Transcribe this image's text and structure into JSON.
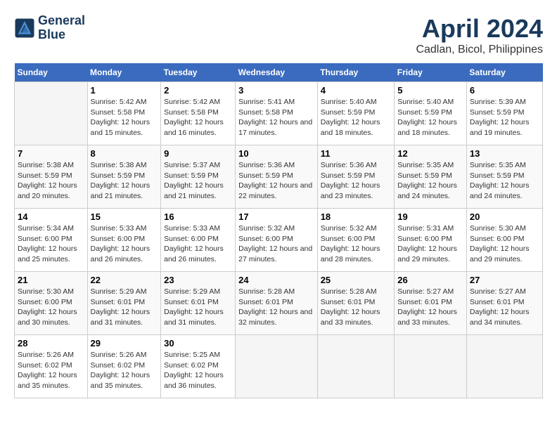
{
  "logo": {
    "line1": "General",
    "line2": "Blue"
  },
  "title": "April 2024",
  "subtitle": "Cadlan, Bicol, Philippines",
  "days_header": [
    "Sunday",
    "Monday",
    "Tuesday",
    "Wednesday",
    "Thursday",
    "Friday",
    "Saturday"
  ],
  "weeks": [
    [
      {
        "num": "",
        "sunrise": "",
        "sunset": "",
        "daylight": ""
      },
      {
        "num": "1",
        "sunrise": "Sunrise: 5:42 AM",
        "sunset": "Sunset: 5:58 PM",
        "daylight": "Daylight: 12 hours and 15 minutes."
      },
      {
        "num": "2",
        "sunrise": "Sunrise: 5:42 AM",
        "sunset": "Sunset: 5:58 PM",
        "daylight": "Daylight: 12 hours and 16 minutes."
      },
      {
        "num": "3",
        "sunrise": "Sunrise: 5:41 AM",
        "sunset": "Sunset: 5:58 PM",
        "daylight": "Daylight: 12 hours and 17 minutes."
      },
      {
        "num": "4",
        "sunrise": "Sunrise: 5:40 AM",
        "sunset": "Sunset: 5:59 PM",
        "daylight": "Daylight: 12 hours and 18 minutes."
      },
      {
        "num": "5",
        "sunrise": "Sunrise: 5:40 AM",
        "sunset": "Sunset: 5:59 PM",
        "daylight": "Daylight: 12 hours and 18 minutes."
      },
      {
        "num": "6",
        "sunrise": "Sunrise: 5:39 AM",
        "sunset": "Sunset: 5:59 PM",
        "daylight": "Daylight: 12 hours and 19 minutes."
      }
    ],
    [
      {
        "num": "7",
        "sunrise": "Sunrise: 5:38 AM",
        "sunset": "Sunset: 5:59 PM",
        "daylight": "Daylight: 12 hours and 20 minutes."
      },
      {
        "num": "8",
        "sunrise": "Sunrise: 5:38 AM",
        "sunset": "Sunset: 5:59 PM",
        "daylight": "Daylight: 12 hours and 21 minutes."
      },
      {
        "num": "9",
        "sunrise": "Sunrise: 5:37 AM",
        "sunset": "Sunset: 5:59 PM",
        "daylight": "Daylight: 12 hours and 21 minutes."
      },
      {
        "num": "10",
        "sunrise": "Sunrise: 5:36 AM",
        "sunset": "Sunset: 5:59 PM",
        "daylight": "Daylight: 12 hours and 22 minutes."
      },
      {
        "num": "11",
        "sunrise": "Sunrise: 5:36 AM",
        "sunset": "Sunset: 5:59 PM",
        "daylight": "Daylight: 12 hours and 23 minutes."
      },
      {
        "num": "12",
        "sunrise": "Sunrise: 5:35 AM",
        "sunset": "Sunset: 5:59 PM",
        "daylight": "Daylight: 12 hours and 24 minutes."
      },
      {
        "num": "13",
        "sunrise": "Sunrise: 5:35 AM",
        "sunset": "Sunset: 5:59 PM",
        "daylight": "Daylight: 12 hours and 24 minutes."
      }
    ],
    [
      {
        "num": "14",
        "sunrise": "Sunrise: 5:34 AM",
        "sunset": "Sunset: 6:00 PM",
        "daylight": "Daylight: 12 hours and 25 minutes."
      },
      {
        "num": "15",
        "sunrise": "Sunrise: 5:33 AM",
        "sunset": "Sunset: 6:00 PM",
        "daylight": "Daylight: 12 hours and 26 minutes."
      },
      {
        "num": "16",
        "sunrise": "Sunrise: 5:33 AM",
        "sunset": "Sunset: 6:00 PM",
        "daylight": "Daylight: 12 hours and 26 minutes."
      },
      {
        "num": "17",
        "sunrise": "Sunrise: 5:32 AM",
        "sunset": "Sunset: 6:00 PM",
        "daylight": "Daylight: 12 hours and 27 minutes."
      },
      {
        "num": "18",
        "sunrise": "Sunrise: 5:32 AM",
        "sunset": "Sunset: 6:00 PM",
        "daylight": "Daylight: 12 hours and 28 minutes."
      },
      {
        "num": "19",
        "sunrise": "Sunrise: 5:31 AM",
        "sunset": "Sunset: 6:00 PM",
        "daylight": "Daylight: 12 hours and 29 minutes."
      },
      {
        "num": "20",
        "sunrise": "Sunrise: 5:30 AM",
        "sunset": "Sunset: 6:00 PM",
        "daylight": "Daylight: 12 hours and 29 minutes."
      }
    ],
    [
      {
        "num": "21",
        "sunrise": "Sunrise: 5:30 AM",
        "sunset": "Sunset: 6:00 PM",
        "daylight": "Daylight: 12 hours and 30 minutes."
      },
      {
        "num": "22",
        "sunrise": "Sunrise: 5:29 AM",
        "sunset": "Sunset: 6:01 PM",
        "daylight": "Daylight: 12 hours and 31 minutes."
      },
      {
        "num": "23",
        "sunrise": "Sunrise: 5:29 AM",
        "sunset": "Sunset: 6:01 PM",
        "daylight": "Daylight: 12 hours and 31 minutes."
      },
      {
        "num": "24",
        "sunrise": "Sunrise: 5:28 AM",
        "sunset": "Sunset: 6:01 PM",
        "daylight": "Daylight: 12 hours and 32 minutes."
      },
      {
        "num": "25",
        "sunrise": "Sunrise: 5:28 AM",
        "sunset": "Sunset: 6:01 PM",
        "daylight": "Daylight: 12 hours and 33 minutes."
      },
      {
        "num": "26",
        "sunrise": "Sunrise: 5:27 AM",
        "sunset": "Sunset: 6:01 PM",
        "daylight": "Daylight: 12 hours and 33 minutes."
      },
      {
        "num": "27",
        "sunrise": "Sunrise: 5:27 AM",
        "sunset": "Sunset: 6:01 PM",
        "daylight": "Daylight: 12 hours and 34 minutes."
      }
    ],
    [
      {
        "num": "28",
        "sunrise": "Sunrise: 5:26 AM",
        "sunset": "Sunset: 6:02 PM",
        "daylight": "Daylight: 12 hours and 35 minutes."
      },
      {
        "num": "29",
        "sunrise": "Sunrise: 5:26 AM",
        "sunset": "Sunset: 6:02 PM",
        "daylight": "Daylight: 12 hours and 35 minutes."
      },
      {
        "num": "30",
        "sunrise": "Sunrise: 5:25 AM",
        "sunset": "Sunset: 6:02 PM",
        "daylight": "Daylight: 12 hours and 36 minutes."
      },
      {
        "num": "",
        "sunrise": "",
        "sunset": "",
        "daylight": ""
      },
      {
        "num": "",
        "sunrise": "",
        "sunset": "",
        "daylight": ""
      },
      {
        "num": "",
        "sunrise": "",
        "sunset": "",
        "daylight": ""
      },
      {
        "num": "",
        "sunrise": "",
        "sunset": "",
        "daylight": ""
      }
    ]
  ]
}
